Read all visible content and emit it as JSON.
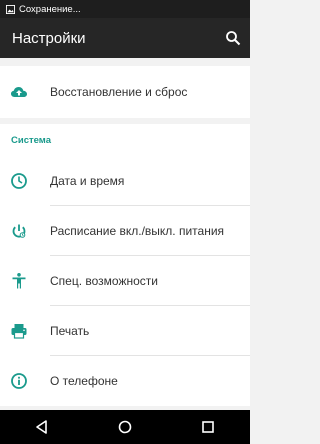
{
  "status_bar": {
    "notification_text": "Сохранение..."
  },
  "app_bar": {
    "title": "Настройки"
  },
  "rows": {
    "backup": "Восстановление и сброс",
    "date_time": "Дата и время",
    "schedule_power": "Расписание вкл./выкл. питания",
    "accessibility": "Спец. возможности",
    "print": "Печать",
    "about_phone": "О телефоне"
  },
  "section": {
    "system": "Система"
  },
  "colors": {
    "accent": "#1a9a8c",
    "icon": "#1a9a8c",
    "toolbar": "#262626",
    "status": "#1e1e1e"
  },
  "icons": {
    "backup": "cloud-upload-icon",
    "date_time": "clock-icon",
    "schedule_power": "power-schedule-icon",
    "accessibility": "accessibility-icon",
    "print": "printer-icon",
    "about_phone": "info-icon",
    "search": "search-icon"
  }
}
